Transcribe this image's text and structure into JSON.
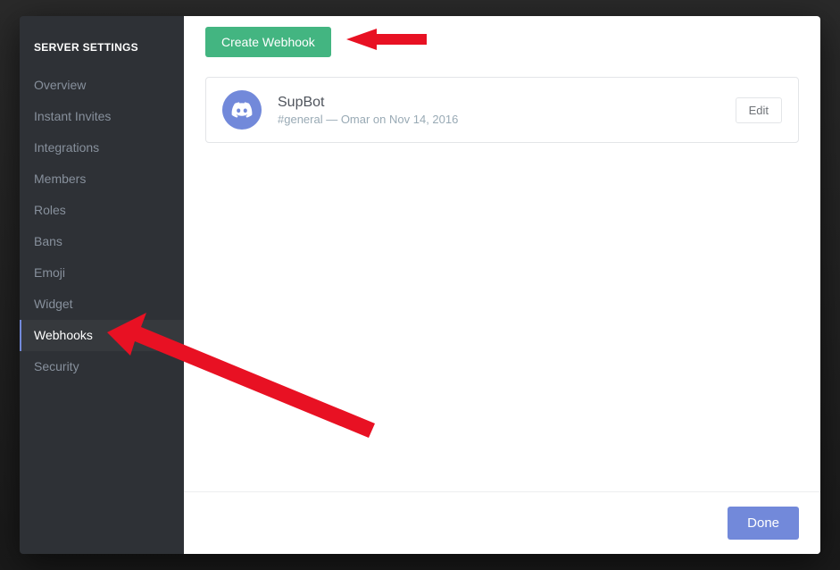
{
  "sidebar": {
    "header": "SERVER SETTINGS",
    "items": [
      {
        "label": "Overview",
        "active": false
      },
      {
        "label": "Instant Invites",
        "active": false
      },
      {
        "label": "Integrations",
        "active": false
      },
      {
        "label": "Members",
        "active": false
      },
      {
        "label": "Roles",
        "active": false
      },
      {
        "label": "Bans",
        "active": false
      },
      {
        "label": "Emoji",
        "active": false
      },
      {
        "label": "Widget",
        "active": false
      },
      {
        "label": "Webhooks",
        "active": true
      },
      {
        "label": "Security",
        "active": false
      }
    ]
  },
  "actions": {
    "create_label": "Create Webhook",
    "edit_label": "Edit",
    "done_label": "Done"
  },
  "webhook": {
    "name": "SupBot",
    "channel": "#general",
    "author": "Omar",
    "date": "Nov 14, 2016",
    "meta": "#general  —  Omar on Nov 14, 2016"
  }
}
